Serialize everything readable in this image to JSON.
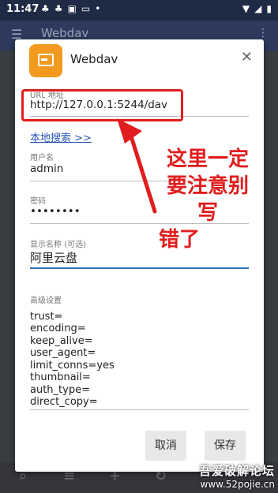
{
  "status_bar": {
    "time": "11:47",
    "left_icons": [
      "club-icon",
      "club-icon",
      "media-icon",
      "monitor-icon",
      "dot-icon"
    ],
    "right_icons": [
      "wifi-icon",
      "signal-icon",
      "battery-icon"
    ]
  },
  "app_bar": {
    "title": "Webdav"
  },
  "dialog": {
    "title": "Webdav",
    "icon": "webdav-storage-icon",
    "url": {
      "label": "URL 地址",
      "value": "http://127.0.0.1:5244/dav"
    },
    "local_search": "本地搜索 >>",
    "username": {
      "label": "用户名",
      "value": "admin"
    },
    "password": {
      "label": "密码",
      "value": "••••••••"
    },
    "display_name": {
      "label": "显示名称 (可选)",
      "value": "阿里云盘"
    },
    "advanced": {
      "label": "高级设置",
      "lines": [
        "trust=",
        "encoding=",
        "keep_alive=",
        "user_agent=",
        "limit_conns=yes",
        "thumbnail=",
        "auth_type=",
        "direct_copy="
      ]
    },
    "buttons": {
      "cancel": "取消",
      "save": "保存"
    }
  },
  "annotation": {
    "lines": [
      "这里一定",
      "要注意别写",
      "错了"
    ],
    "color": "#e11d1d"
  },
  "watermark": {
    "title": "吾爱破解论坛",
    "url": "www.52pojie.cn"
  },
  "colors": {
    "accent": "#2f6fc4",
    "icon_bg": "#f29a1f",
    "highlight": "#e11d1d"
  }
}
